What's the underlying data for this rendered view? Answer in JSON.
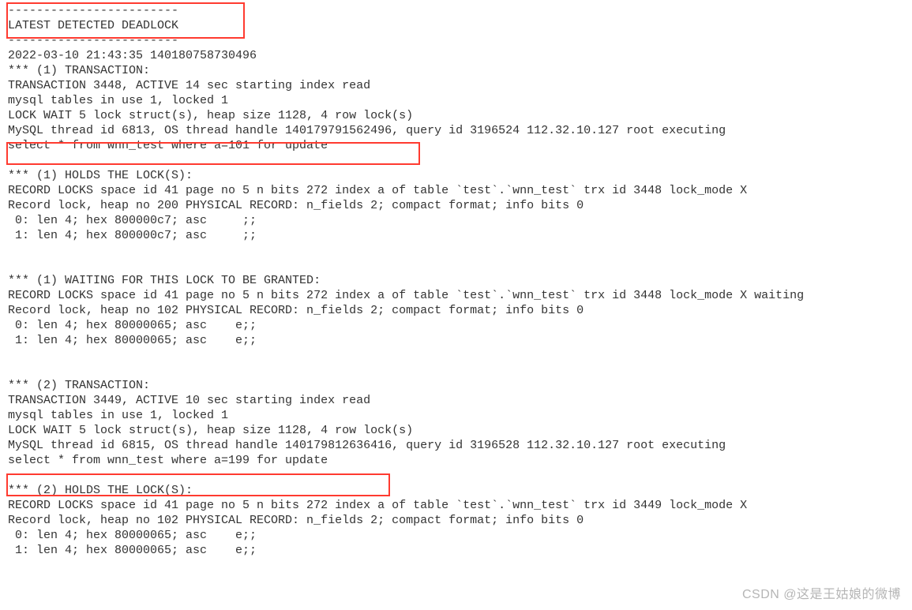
{
  "lines": [
    "------------------------",
    "LATEST DETECTED DEADLOCK",
    "------------------------",
    "2022-03-10 21:43:35 140180758730496",
    "*** (1) TRANSACTION:",
    "TRANSACTION 3448, ACTIVE 14 sec starting index read",
    "mysql tables in use 1, locked 1",
    "LOCK WAIT 5 lock struct(s), heap size 1128, 4 row lock(s)",
    "MySQL thread id 6813, OS thread handle 140179791562496, query id 3196524 112.32.10.127 root executing",
    "select * from wnn_test where a=101 for update",
    "",
    "*** (1) HOLDS THE LOCK(S):",
    "RECORD LOCKS space id 41 page no 5 n bits 272 index a of table `test`.`wnn_test` trx id 3448 lock_mode X",
    "Record lock, heap no 200 PHYSICAL RECORD: n_fields 2; compact format; info bits 0",
    " 0: len 4; hex 800000c7; asc     ;;",
    " 1: len 4; hex 800000c7; asc     ;;",
    "",
    "",
    "*** (1) WAITING FOR THIS LOCK TO BE GRANTED:",
    "RECORD LOCKS space id 41 page no 5 n bits 272 index a of table `test`.`wnn_test` trx id 3448 lock_mode X waiting",
    "Record lock, heap no 102 PHYSICAL RECORD: n_fields 2; compact format; info bits 0",
    " 0: len 4; hex 80000065; asc    e;;",
    " 1: len 4; hex 80000065; asc    e;;",
    "",
    "",
    "*** (2) TRANSACTION:",
    "TRANSACTION 3449, ACTIVE 10 sec starting index read",
    "mysql tables in use 1, locked 1",
    "LOCK WAIT 5 lock struct(s), heap size 1128, 4 row lock(s)",
    "MySQL thread id 6815, OS thread handle 140179812636416, query id 3196528 112.32.10.127 root executing",
    "select * from wnn_test where a=199 for update",
    "",
    "*** (2) HOLDS THE LOCK(S):",
    "RECORD LOCKS space id 41 page no 5 n bits 272 index a of table `test`.`wnn_test` trx id 3449 lock_mode X",
    "Record lock, heap no 102 PHYSICAL RECORD: n_fields 2; compact format; info bits 0",
    " 0: len 4; hex 80000065; asc    e;;",
    " 1: len 4; hex 80000065; asc    e;;",
    "",
    ""
  ],
  "highlights": {
    "box1_desc": "header-latest-detected-deadlock",
    "box2_desc": "select-101-for-update",
    "box3_desc": "select-199-for-update"
  },
  "watermark": "CSDN @这是王姑娘的微博"
}
